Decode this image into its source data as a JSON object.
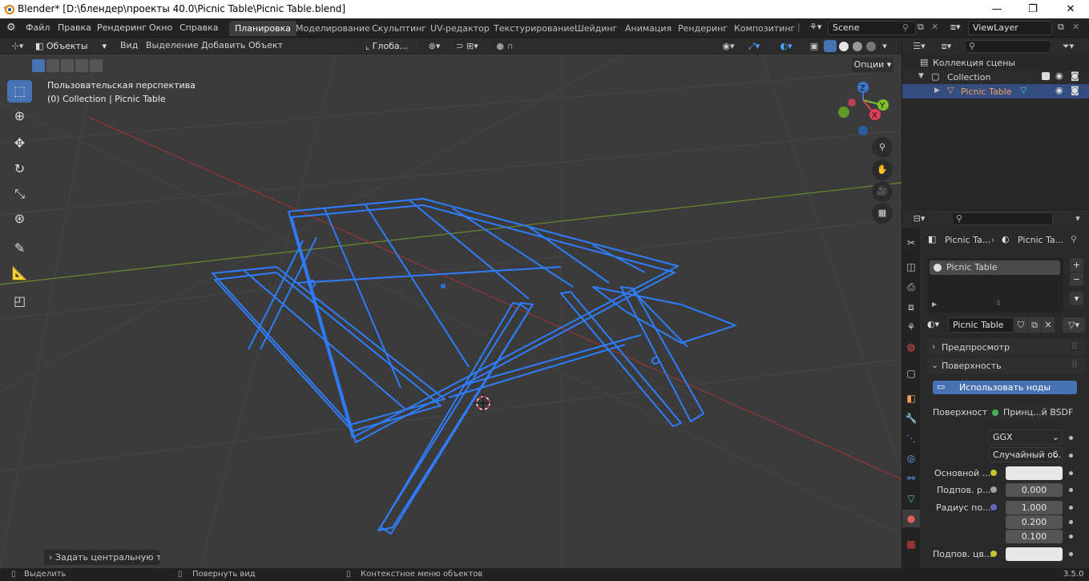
{
  "window": {
    "title": "Blender* [D:\\блендер\\проекты 40.0\\Picnic Table\\Picnic Table.blend]",
    "minimize": "—",
    "maximize": "❐",
    "close": "✕"
  },
  "menus": [
    "Файл",
    "Правка",
    "Рендеринг",
    "Окно",
    "Справка"
  ],
  "workspaces": [
    {
      "label": "Планировка",
      "active": true
    },
    {
      "label": "Моделирование"
    },
    {
      "label": "Скульптинг"
    },
    {
      "label": "UV-редактор"
    },
    {
      "label": "Текстурирование"
    },
    {
      "label": "Шейдинг"
    },
    {
      "label": "Анимация"
    },
    {
      "label": "Рендеринг"
    },
    {
      "label": "Композитинг"
    }
  ],
  "scene": {
    "name": "Scene",
    "view_layer": "ViewLayer"
  },
  "viewport_header": {
    "mode": "Объекты",
    "menus": [
      "Вид",
      "Выделение",
      "Добавить",
      "Объект"
    ],
    "orientation": "Глоба...",
    "options": "Опции"
  },
  "viewport": {
    "perspective_label": "Пользовательская перспектива",
    "collection_label": "(0) Collection | Picnic Table",
    "last_op": "Задать центральную точк",
    "gizmo": {
      "z": "Z",
      "y": "Y",
      "x": "X"
    }
  },
  "outliner": {
    "scene_collection": "Коллекция сцены",
    "collection": "Collection",
    "object": "Picnic Table"
  },
  "properties": {
    "breadcrumb_object": "Picnic Ta...",
    "breadcrumb_material": "Picnic Ta...",
    "slot_name": "Picnic Table",
    "material_name": "Picnic Table",
    "panel_preview": "Предпросмотр",
    "panel_surface": "Поверхность",
    "use_nodes": "Использовать ноды",
    "surface_label": "Поверхность",
    "surface_value": "Принц...й BSDF",
    "distribution": "GGX",
    "subsurface_method": "Случайный об...",
    "rows": [
      {
        "label": "Основной ...",
        "value": ""
      },
      {
        "label": "Подпов. р...",
        "value": "0.000"
      },
      {
        "label": "Радиус по...",
        "value": "1.000"
      },
      {
        "label": "",
        "value": "0.200"
      },
      {
        "label": "",
        "value": "0.100"
      },
      {
        "label": "Подпов. цв...",
        "value": ""
      }
    ]
  },
  "status": {
    "select": "Выделить",
    "rotate": "Повернуть вид",
    "context": "Контекстное меню объектов",
    "version": "3.5.0"
  },
  "colors": {
    "accent": "#4772b3",
    "wire": "#2f7dff",
    "object_label": "#f0a45a"
  }
}
